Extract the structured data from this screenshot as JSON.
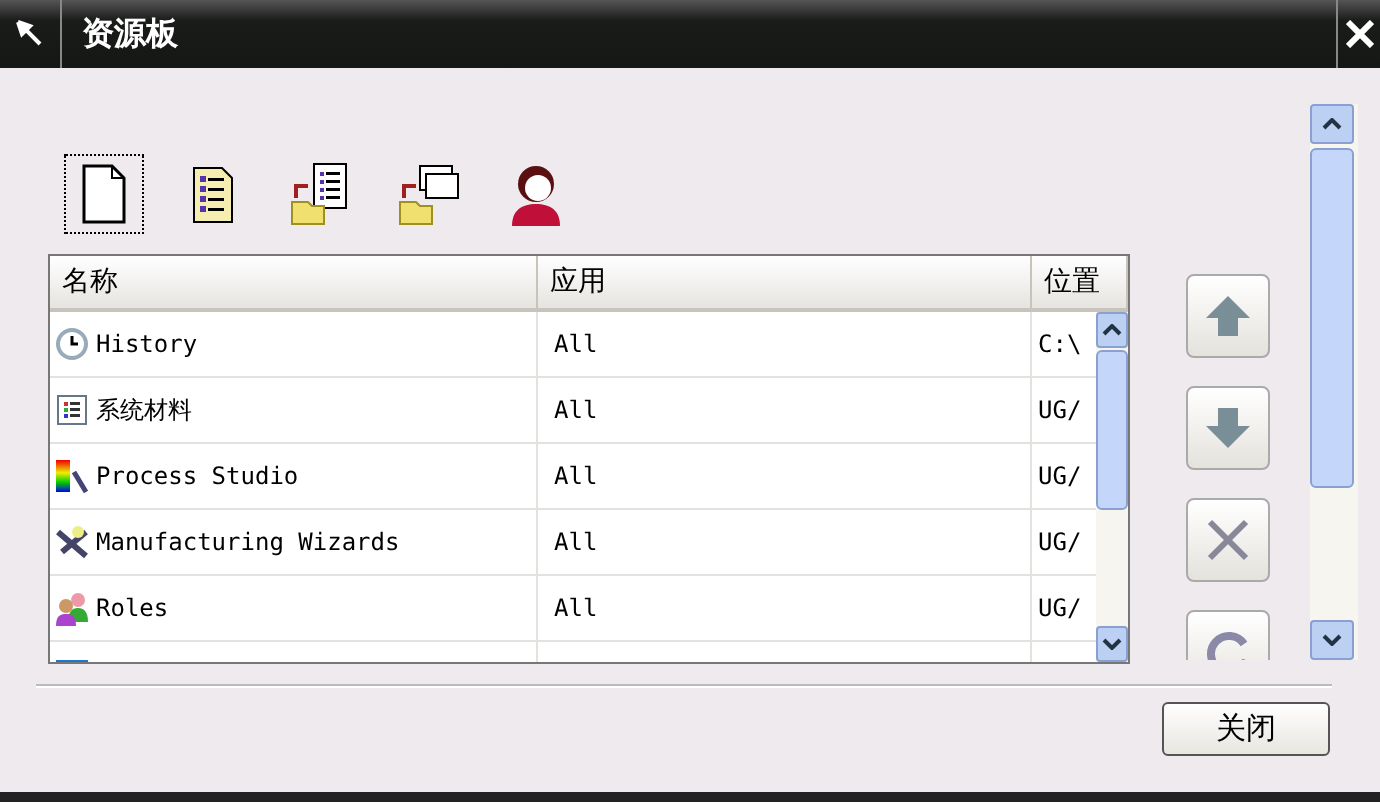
{
  "window": {
    "title": "资源板"
  },
  "toolbar": [
    {
      "kind": "new"
    },
    {
      "kind": "list"
    },
    {
      "kind": "open-list"
    },
    {
      "kind": "open-windows"
    },
    {
      "kind": "user"
    }
  ],
  "table": {
    "columns": [
      "名称",
      "应用",
      "位置"
    ],
    "rows": [
      {
        "kind": "clock",
        "name": "History",
        "app": "All",
        "location": "C:\\"
      },
      {
        "kind": "palette",
        "name": "系统材料",
        "app": "All",
        "location": "UG/"
      },
      {
        "kind": "rainbow",
        "name": "Process Studio",
        "app": "All",
        "location": "UG/"
      },
      {
        "kind": "wizard",
        "name": "Manufacturing Wizards",
        "app": "All",
        "location": "UG/"
      },
      {
        "kind": "people",
        "name": "Roles",
        "app": "All",
        "location": "UG/"
      },
      {
        "kind": "screen"
      }
    ]
  },
  "side_buttons": [
    {
      "kind": "up"
    },
    {
      "kind": "down"
    },
    {
      "kind": "delete"
    },
    {
      "kind": "refresh"
    }
  ],
  "buttons": [
    "关闭"
  ]
}
